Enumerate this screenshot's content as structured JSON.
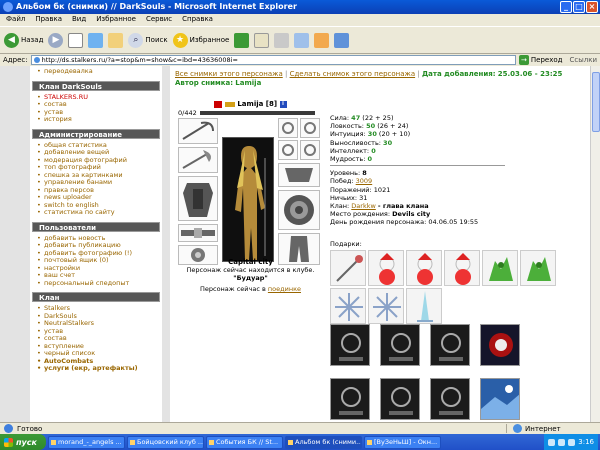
{
  "window": {
    "title": "Альбом бк (снимки) // DarkSouls - Microsoft Internet Explorer"
  },
  "menu": [
    "Файл",
    "Правка",
    "Вид",
    "Избранное",
    "Сервис",
    "Справка"
  ],
  "toolbar": {
    "back": "Назад",
    "search": "Поиск",
    "favorites": "Избранное"
  },
  "address": {
    "label": "Адрес:",
    "url": "http://ds.stalkers.ru/?a=stop&m=show&c=ibd=43636008i=",
    "go": "Переход",
    "links": "Ссылки"
  },
  "sidebar": {
    "top_items": [
      "переодевалка"
    ],
    "sections": [
      {
        "title": "Клан DarkSouls",
        "items": [
          {
            "label": "STALKERS.RU",
            "style": "red"
          },
          {
            "label": "состав"
          },
          {
            "label": "устав"
          },
          {
            "label": "история"
          }
        ]
      },
      {
        "title": "Администрирование",
        "items": [
          {
            "label": "общая статистика"
          },
          {
            "label": "добавление вещей"
          },
          {
            "label": "модерация фотографий"
          },
          {
            "label": "топ фотографий"
          },
          {
            "label": "спешка за картинками"
          },
          {
            "label": "управление банами"
          },
          {
            "label": "правка персов"
          },
          {
            "label": "news uploader"
          },
          {
            "label": "switch to english"
          },
          {
            "label": "статистика по сайту"
          }
        ]
      },
      {
        "title": "Пользователи",
        "items": [
          {
            "label": "добавить новость"
          },
          {
            "label": "добавить публикацию"
          },
          {
            "label": "добавить фотографию (!)"
          },
          {
            "label": "почтовый ящик (0)"
          },
          {
            "label": "настройки"
          },
          {
            "label": "ваш счет"
          },
          {
            "label": "персональный спедопыт"
          }
        ]
      },
      {
        "title": "Клан",
        "items": [
          {
            "label": "Stalkers"
          },
          {
            "label": "DarkSouls"
          },
          {
            "label": "NeutralStalkers"
          },
          {
            "label": "устав"
          },
          {
            "label": "состав"
          },
          {
            "label": "вступление"
          },
          {
            "label": "черный список"
          },
          {
            "label": "AutoCombats",
            "style": "bold"
          },
          {
            "label": "услуги (екр, артефакты)",
            "style": "bold"
          }
        ]
      }
    ]
  },
  "main": {
    "link_all": "Все снимки этого персонажа",
    "sep": "|",
    "link_make": "Сделать снимок этого персонажа",
    "date_label": "Дата добавления:",
    "date": "25.03.06 - 23:25",
    "author_label": "Автор снимка:",
    "author": "Lamija",
    "character": {
      "name": "Lamija",
      "level": "[8]",
      "badge": "i",
      "hp": "0/442",
      "city": "Capital city",
      "location_text": "Персонаж сейчас находится в клубе.",
      "room": "\"Будуар\"",
      "duel_text": "Персонаж сейчас в",
      "duel_link": "поединке"
    },
    "stats": [
      {
        "label": "Сила:",
        "value": "47",
        "extra": "(22 + 25)"
      },
      {
        "label": "Ловкость:",
        "value": "50",
        "extra": "(26 + 24)"
      },
      {
        "label": "Интуиция:",
        "value": "30",
        "extra": "(20 + 10)"
      },
      {
        "label": "Выносливость:",
        "value": "30",
        "extra": ""
      },
      {
        "label": "Интеллект:",
        "value": "0",
        "extra": ""
      },
      {
        "label": "Мудрость:",
        "value": "0",
        "extra": ""
      }
    ],
    "info": {
      "level_label": "Уровень:",
      "level": "8",
      "wins_label": "Побед:",
      "wins": "3009",
      "losses_label": "Поражений:",
      "losses": "1021",
      "draws_label": "Ничьих:",
      "draws": "31",
      "clan_label": "Клан:",
      "clan": "Darkkw",
      "clan_role": "- глава клана",
      "birth_label": "Место рождения:",
      "birth": "Devils city",
      "bday_label": "День рождения персонажа:",
      "bday": "04.06.05 19:55"
    },
    "gifts_label": "Подарки:",
    "gifts": [
      "rose-charm",
      "teddy-bear",
      "teddy-bear",
      "teddy-bear",
      "green-dragon",
      "green-dragon",
      "snowflake",
      "snowflake",
      "ice-tower"
    ],
    "pictures": [
      "dark-card",
      "dark-card",
      "dark-card",
      "red-emblem",
      "dark-card",
      "dark-card",
      "dark-card",
      "blue-scene"
    ]
  },
  "status": {
    "done": "Готово",
    "zone": "Интернет"
  },
  "taskbar": {
    "start": "пуск",
    "tasks": [
      "morand_-_angels ...",
      "Бойцовский клуб ...",
      "События БК // St...",
      "Альбом бк (сними...",
      "[ВуЗеНьШ] - Окн..."
    ],
    "active": 3,
    "clock": "3:16"
  }
}
